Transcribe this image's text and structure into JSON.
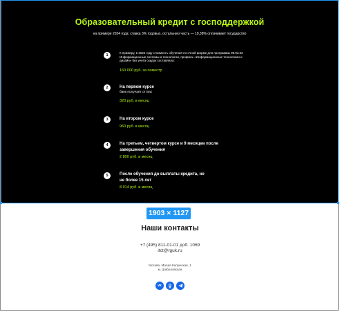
{
  "credit": {
    "title": "Образовательный кредит с господдержкой",
    "subtitle": "на примере 2024 года: ставка 3% годовых, остальную часть — 19,38% оплачивает государство",
    "steps": [
      {
        "num": "1",
        "text": "К примеру, в 2024 году стоимость обучения по очной форме для программы 09.03.02 Информационные системы и технологии, профиль «Информационные технологии и дизайн» без учета скидок составляла:",
        "price": "160 000 руб. за семестр"
      },
      {
        "num": "2",
        "text": "На первом курсе",
        "sub": "банк получает от Вас",
        "price": "320 руб. в месяц"
      },
      {
        "num": "3",
        "text": "На втором курсе",
        "price": "960 руб. в месяц"
      },
      {
        "num": "4",
        "text": "На третьем, четвертом курсе и 9 месяцев после завершения обучения",
        "price": "2 800 руб. в месяц"
      },
      {
        "num": "5",
        "text": "После обучения до выплаты кредита, но не более 15 лет",
        "price": "8 914 руб. в месяц"
      }
    ]
  },
  "badge": {
    "label": "1903 × 1127"
  },
  "contacts": {
    "title": "Наши контакты",
    "phone": "+7 (495) 811-01-01 доб. 1069",
    "email": "itct@rguk.ru",
    "address": "Москва, Малая Калужская, 1",
    "metro": "м. Шаболовская",
    "socials": [
      {
        "icon": "vk-icon",
        "label": "vk"
      },
      {
        "icon": "ok-icon",
        "label": "ok"
      },
      {
        "icon": "telegram-icon",
        "label": "tg"
      }
    ]
  },
  "colors": {
    "accent": "#b7f516",
    "selection": "#2196f3",
    "social": "#1565e8"
  }
}
